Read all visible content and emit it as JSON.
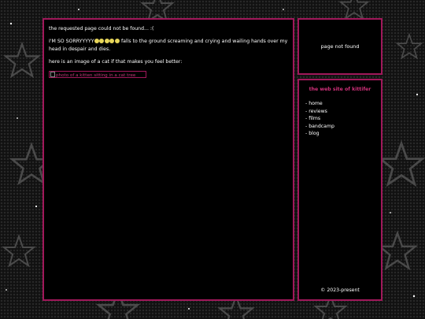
{
  "main": {
    "line1": "the requested page could not be found... :(",
    "line2_prefix": "I'M SO SORRYYYYY",
    "emoji_count": 5,
    "line2_suffix": " falls to the ground screaming and crying and wailing hands over my head in despair and dies.",
    "line3": "here is an image of a cat if that makes you feel better:",
    "image_alt": "photo of a kitten sitting in a cat tree"
  },
  "status": {
    "text": "page not found"
  },
  "nav": {
    "title": "the web site of kittifer",
    "items": [
      {
        "label": "- home"
      },
      {
        "label": "- reviews"
      },
      {
        "label": "- films"
      },
      {
        "label": "- bandcamp"
      },
      {
        "label": "- blog"
      }
    ],
    "footer": "© 2023-present"
  },
  "colors": {
    "accent": "#a0185a",
    "title": "#d0307a",
    "background": "#111111",
    "panel": "#000000",
    "emoji": "#e8d65a"
  },
  "icons": {
    "background_stars": "star-icon",
    "emoji": "crying-face-icon",
    "broken_image": "broken-image-icon"
  }
}
